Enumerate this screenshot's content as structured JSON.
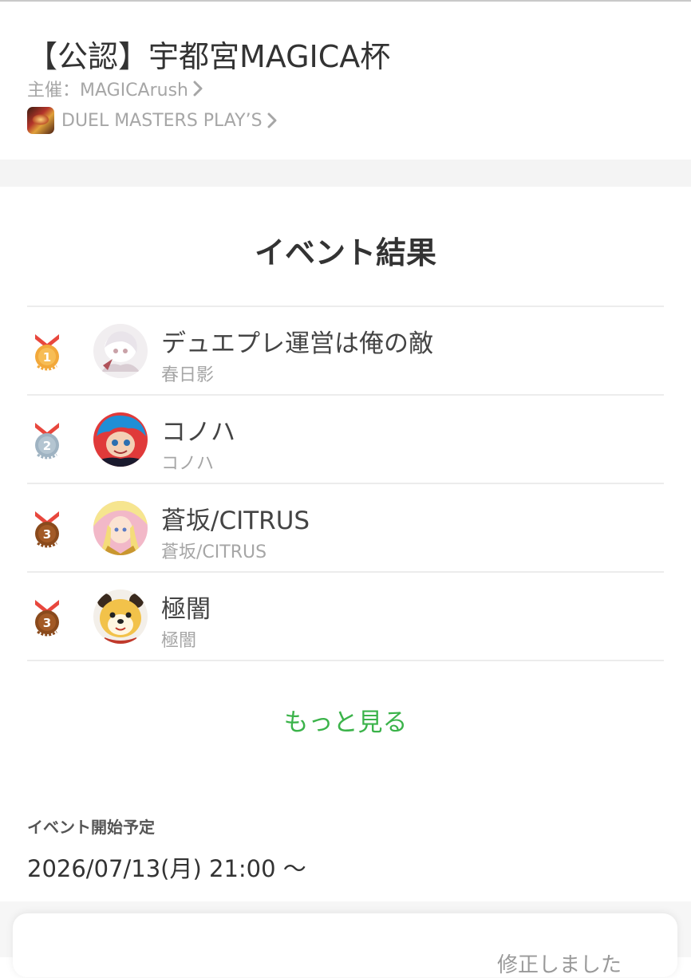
{
  "event": {
    "title": "【公認】宇都宮MAGICA杯",
    "organizer_label": "主催：MAGICArush",
    "game_name": "DUEL MASTERS PLAY’S"
  },
  "results": {
    "heading": "イベント結果",
    "entries": [
      {
        "rank": "1",
        "medal": "gold",
        "name": "デュエプレ運営は俺の敵",
        "sub": "春日影"
      },
      {
        "rank": "2",
        "medal": "silver",
        "name": "コノハ",
        "sub": "コノハ"
      },
      {
        "rank": "3",
        "medal": "bronze",
        "name": "蒼坂/CITRUS",
        "sub": "蒼坂/CITRUS"
      },
      {
        "rank": "3",
        "medal": "bronze",
        "name": "極闇",
        "sub": "極闇"
      }
    ],
    "more_label": "もっと見る"
  },
  "schedule": {
    "label": "イベント開始予定",
    "value": "2026/07/13(月) 21:00 ～"
  },
  "bottom_card": {
    "partial_text": "修正しました"
  },
  "colors": {
    "accent_green": "#3bb34a",
    "gold": "#f2a83a",
    "silver": "#9fb3c2",
    "bronze": "#8a4a1c",
    "ribbon_red": "#e8473d"
  },
  "icons": [
    "chevron-right-icon",
    "game-icon",
    "gold-medal-icon",
    "silver-medal-icon",
    "bronze-medal-icon"
  ]
}
